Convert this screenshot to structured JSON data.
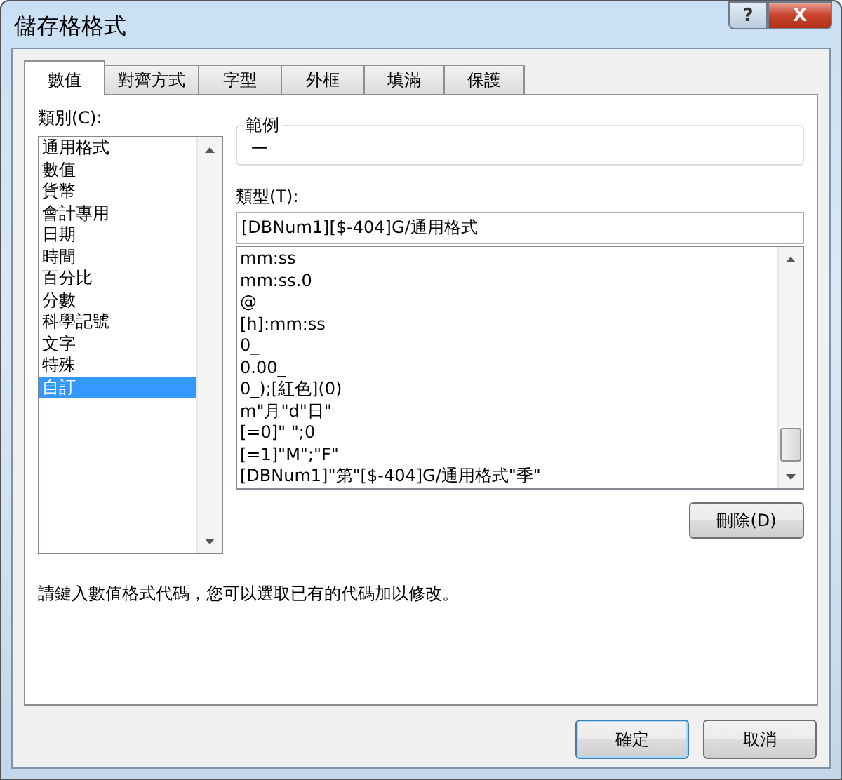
{
  "window": {
    "title": "儲存格格式",
    "help_button": "?",
    "close_button": "X"
  },
  "tabs": [
    {
      "label": "數值",
      "selected": true
    },
    {
      "label": "對齊方式",
      "selected": false
    },
    {
      "label": "字型",
      "selected": false
    },
    {
      "label": "外框",
      "selected": false
    },
    {
      "label": "填滿",
      "selected": false
    },
    {
      "label": "保護",
      "selected": false
    }
  ],
  "category": {
    "label": "類別(C):",
    "items": [
      {
        "label": "通用格式",
        "selected": false
      },
      {
        "label": "數值",
        "selected": false
      },
      {
        "label": "貨幣",
        "selected": false
      },
      {
        "label": "會計專用",
        "selected": false
      },
      {
        "label": "日期",
        "selected": false
      },
      {
        "label": "時間",
        "selected": false
      },
      {
        "label": "百分比",
        "selected": false
      },
      {
        "label": "分數",
        "selected": false
      },
      {
        "label": "科學記號",
        "selected": false
      },
      {
        "label": "文字",
        "selected": false
      },
      {
        "label": "特殊",
        "selected": false
      },
      {
        "label": "自訂",
        "selected": true
      }
    ]
  },
  "sample": {
    "legend": "範例",
    "value": "一"
  },
  "type": {
    "label": "類型(T):",
    "value": "[DBNum1][$-404]G/通用格式",
    "items": [
      "mm:ss",
      "mm:ss.0",
      "@",
      "[h]:mm:ss",
      "0_",
      "0.00_",
      "0_);[紅色](0)",
      "m\"月\"d\"日\"",
      "[=0]\" \";0",
      "[=1]\"M\";\"F\"",
      "[DBNum1]\"第\"[$-404]G/通用格式\"季\""
    ]
  },
  "delete_button": "刪除(D)",
  "hint": "請鍵入數值格式代碼，您可以選取已有的代碼加以修改。",
  "buttons": [
    {
      "label": "確定",
      "default": true
    },
    {
      "label": "取消",
      "default": false
    }
  ]
}
